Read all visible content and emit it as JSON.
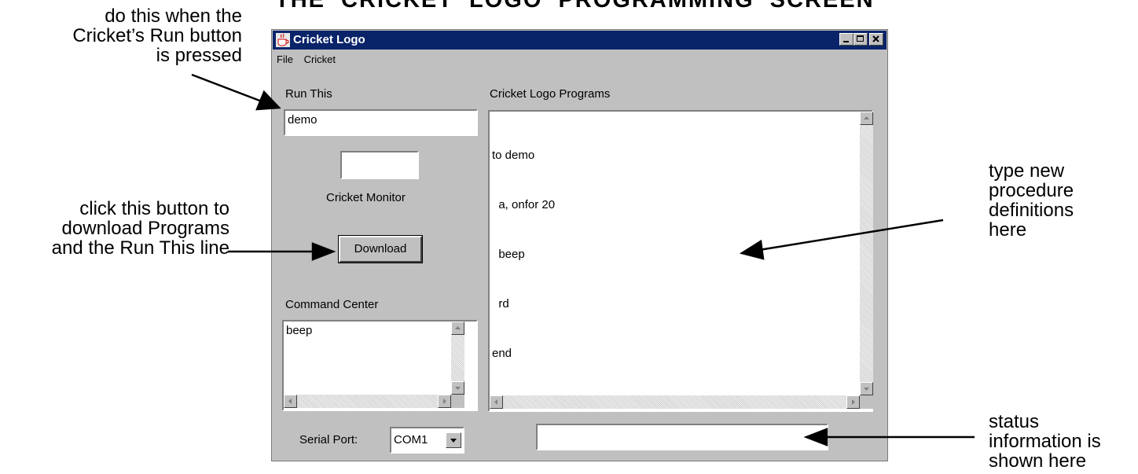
{
  "page_title": "THE CRICKET LOGO PROGRAMMING SCREEN",
  "annotations": {
    "run_this": [
      "do this when the",
      "Cricket’s Run button",
      "is pressed"
    ],
    "download": [
      "click this button to",
      "download Programs",
      "and the Run This line"
    ],
    "procedures": [
      "type new",
      "procedure",
      "definitions",
      "here"
    ],
    "status": [
      "status",
      "information is",
      "shown here"
    ]
  },
  "window": {
    "title": "Cricket Logo",
    "menu": [
      "File",
      "Cricket"
    ],
    "run_this": {
      "label": "Run This",
      "value": "demo"
    },
    "monitor": {
      "label": "Cricket Monitor",
      "value": ""
    },
    "download_button": "Download",
    "command_center": {
      "label": "Command Center",
      "value": "beep"
    },
    "programs": {
      "label": "Cricket Logo Programs",
      "lines": [
        "to demo",
        "  a, onfor 20",
        "  beep",
        "  rd",
        "end"
      ]
    },
    "serial_port": {
      "label": "Serial Port:",
      "value": "COM1"
    },
    "status": ""
  }
}
